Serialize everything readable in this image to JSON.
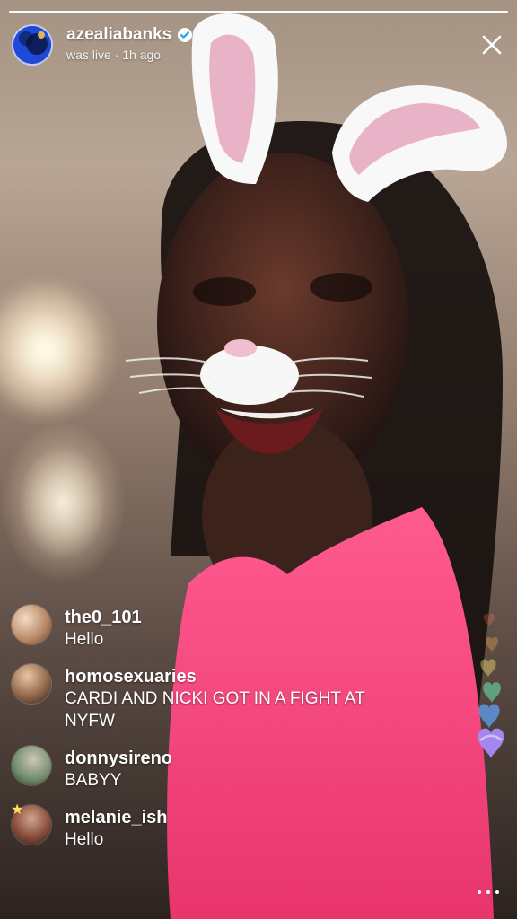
{
  "header": {
    "username": "azealiabanks",
    "subtext": "was live · 1h ago",
    "avatar_icon": "profile-avatar-icon",
    "verified_icon": "verified-badge-icon",
    "close_icon": "close-icon"
  },
  "playback": {
    "progress_fraction": 1.0
  },
  "comments": [
    {
      "user": "the0_101",
      "text": "Hello",
      "avatar_icon": "user-avatar-icon"
    },
    {
      "user": "homosexuaries",
      "text": "CARDI AND NICKI GOT IN A FIGHT AT NYFW",
      "avatar_icon": "user-avatar-icon"
    },
    {
      "user": "donnysireno",
      "text": "BABYY",
      "avatar_icon": "user-avatar-icon"
    },
    {
      "user": "melanie_ish",
      "text": "Hello",
      "avatar_icon": "user-avatar-icon"
    }
  ],
  "reactions": {
    "hearts_icon": "hearts-reaction-icon",
    "heart_colors": [
      "#ff7a59",
      "#ffb347",
      "#ffe66d",
      "#6ee7b7",
      "#60a5fa",
      "#a78bfa",
      "#f472b6"
    ]
  },
  "actions": {
    "more_icon": "more-options-icon"
  },
  "colors": {
    "text": "#ffffff",
    "verified": "#1da1f2",
    "shirt": "#ff4f86"
  }
}
